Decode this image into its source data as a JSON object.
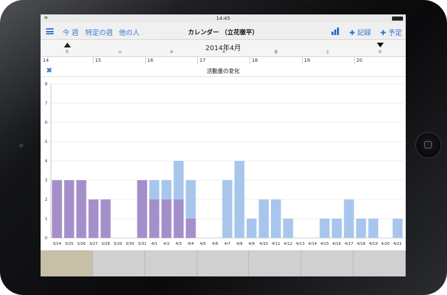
{
  "status_bar": {
    "time": "14:45"
  },
  "navbar": {
    "week_label": "今 週",
    "specific_week_label": "特定の週",
    "other_person_label": "他の人",
    "title": "カレンダー （立花徹平）",
    "record_label": "✚ 記録",
    "plan_label": "✚ 予定"
  },
  "calendar": {
    "month_title": "2014年4月",
    "weekdays": [
      "月",
      "火",
      "水",
      "木",
      "金",
      "土",
      "日"
    ],
    "dates": [
      "14",
      "15",
      "16",
      "17",
      "18",
      "19",
      "20"
    ]
  },
  "popup": {
    "title": "活動量の変化"
  },
  "tabs_count": 7,
  "colors": {
    "accent": "#2f6fd0",
    "purple": "#a48fcb",
    "blue": "#a8c6ec",
    "active_tab": "#c8bfa8"
  },
  "chart_data": {
    "type": "bar",
    "categories": [
      "3/24",
      "3/25",
      "3/26",
      "3/27",
      "3/28",
      "3/29",
      "3/30",
      "3/31",
      "4/1",
      "4/2",
      "4/3",
      "4/4",
      "4/5",
      "4/6",
      "4/7",
      "4/8",
      "4/9",
      "4/10",
      "4/11",
      "4/12",
      "4/13",
      "4/14",
      "4/15",
      "4/16",
      "4/17",
      "4/18",
      "4/19",
      "4/20",
      "4/21"
    ],
    "series": [
      {
        "values": [
          3,
          3,
          3,
          2,
          2,
          0,
          0,
          3,
          2,
          2,
          2,
          1,
          0,
          0,
          0,
          0,
          0,
          0,
          0,
          0,
          0,
          0,
          0,
          0,
          0,
          0,
          0,
          0,
          0
        ]
      },
      {
        "values": [
          0,
          0,
          0,
          0,
          0,
          0,
          0,
          0,
          1,
          1,
          2,
          2,
          0,
          0,
          3,
          4,
          1,
          2,
          2,
          1,
          0,
          0,
          1,
          1,
          2,
          1,
          1,
          0,
          1
        ]
      }
    ],
    "stacked": true,
    "ylim": [
      0,
      8
    ],
    "yticks": [
      0,
      1,
      2,
      3,
      4,
      5,
      6,
      7,
      8
    ],
    "grid": true
  }
}
